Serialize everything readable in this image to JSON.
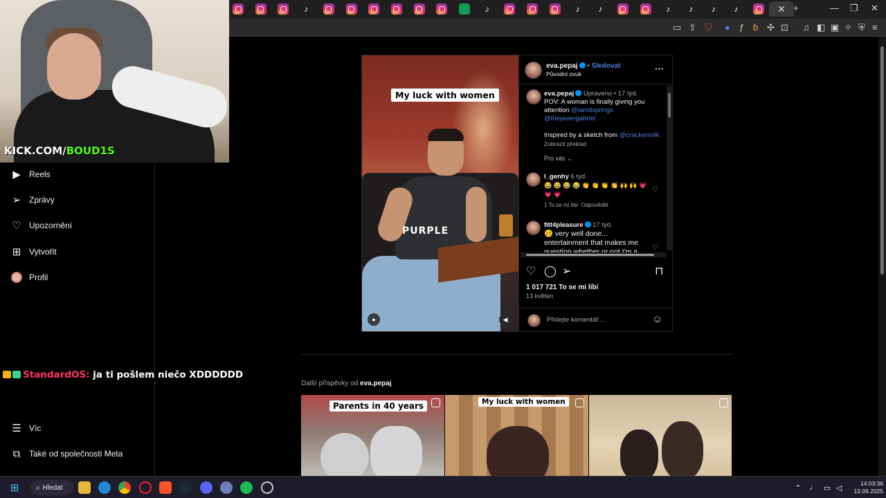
{
  "stream": {
    "overlay_white": "KICK.COM/",
    "overlay_green": "BOUD1S",
    "chat_user": "StandardOS:",
    "chat_message": "ja ti pošlem niečo XDDDDDD"
  },
  "browser": {
    "tabs": [
      "ig",
      "ig",
      "ig",
      "tt",
      "ig",
      "ig",
      "ig",
      "ig",
      "ig",
      "ig",
      "gr",
      "tt",
      "ig",
      "ig",
      "ig",
      "tt",
      "tt",
      "ig",
      "ig",
      "tt",
      "tt",
      "tt",
      "tt",
      "ig"
    ],
    "active_tab_close": "✕",
    "new_tab": "+",
    "min": "—",
    "restore": "❐",
    "close": "✕"
  },
  "nav": {
    "items": [
      {
        "label": "Reels",
        "icon": "reels-icon"
      },
      {
        "label": "Zprávy",
        "icon": "messages-icon"
      },
      {
        "label": "Upozornění",
        "icon": "heart-icon"
      },
      {
        "label": "Vytvořit",
        "icon": "plus-square-icon"
      },
      {
        "label": "Profil",
        "icon": "avatar"
      }
    ],
    "more": "Víc",
    "meta": "Také od společnosti Meta"
  },
  "post": {
    "overlay_caption": "My luck with women",
    "shirt_text": "PURPLE",
    "author": "eva.pepaj",
    "follow": "Sledovat",
    "dot_sep": "•",
    "audio": "Původní zvuk",
    "caption": {
      "edited": "Upraveno",
      "time": "17 týd.",
      "text": "POV: A woman is finally giving you attention",
      "mention1": "@iamdsprings",
      "mention2": "@thejaviergabriel",
      "inspired": "Inspired by a sketch from",
      "mention3": "@crackermilk",
      "translate": "Zobrazit překlad",
      "for_you": "Pro vás"
    },
    "comments": [
      {
        "user": "l_genhy",
        "time": "6 týd.",
        "text": "😂 😂 😂 😂 👏 👏 👏 👏 🙌 🙌 💗 💗 💗",
        "likes": "1 To se mi líbí",
        "reply": "Odpovědět"
      },
      {
        "user": "fitt4pleasure",
        "time": "17 týd.",
        "text_line1": "🥴 very well done...",
        "text_line2": "entertainment that makes me",
        "text_line3": "question whether or not I'm a"
      }
    ],
    "likes": "1 017 721 To se mi líbí",
    "date": "13 květen",
    "comment_placeholder": "Přidejte komentář..."
  },
  "more_posts": {
    "label": "Další příspěvky od",
    "author": "eva.pepaj",
    "items": [
      {
        "caption": "Parents in 40 years"
      },
      {
        "caption": "My luck with women"
      },
      {
        "caption": ""
      }
    ]
  },
  "taskbar": {
    "search": "Hledat",
    "time": "14:03:36",
    "date": "13.09.2025"
  }
}
